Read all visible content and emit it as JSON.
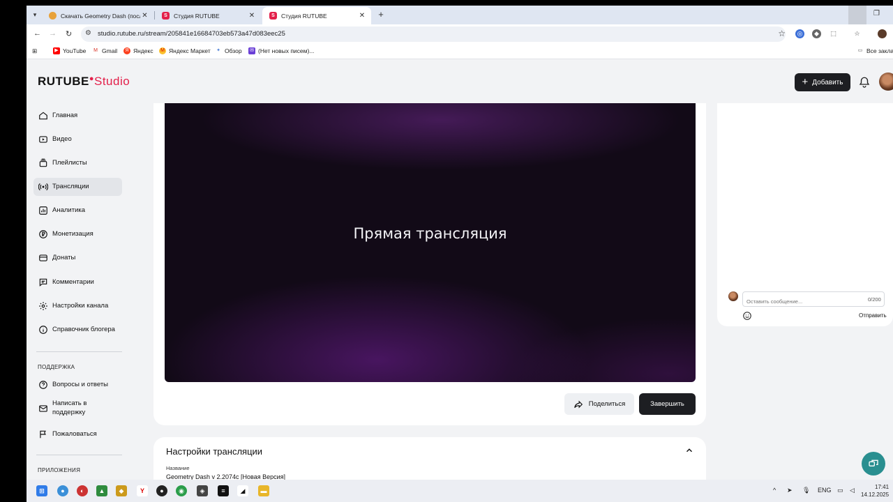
{
  "browser": {
    "tabs": [
      {
        "title": "Скачать Geometry Dash (после",
        "icon": "geometry-dash-favicon"
      },
      {
        "title": "Студия RUTUBE",
        "icon": "rutube-favicon"
      },
      {
        "title": "Студия RUTUBE",
        "icon": "rutube-favicon",
        "active": true
      }
    ],
    "url": "studio.rutube.ru/stream/205841e16684703eb573a47d083eec25",
    "bookmarks": [
      "YouTube",
      "Gmail",
      "Яндекс",
      "Яндекс Маркет",
      "Обзор",
      "(Нет новых писем)..."
    ],
    "all_bookmarks": "Все закла"
  },
  "header": {
    "logo_main": "RUTUBE",
    "logo_studio": "Studio",
    "add_button": "Добавить"
  },
  "sidebar": {
    "items": [
      {
        "label": "Главная",
        "icon": "home-icon"
      },
      {
        "label": "Видео",
        "icon": "video-icon"
      },
      {
        "label": "Плейлисты",
        "icon": "playlist-icon"
      },
      {
        "label": "Трансляции",
        "icon": "broadcast-icon",
        "active": true
      },
      {
        "label": "Аналитика",
        "icon": "analytics-icon"
      },
      {
        "label": "Монетизация",
        "icon": "ruble-icon"
      },
      {
        "label": "Донаты",
        "icon": "donate-icon"
      },
      {
        "label": "Комментарии",
        "icon": "comment-icon"
      },
      {
        "label": "Настройки канала",
        "icon": "gear-icon"
      },
      {
        "label": "Справочник блогера",
        "icon": "info-icon"
      }
    ],
    "support_heading": "ПОДДЕРЖКА",
    "support_items": [
      {
        "label": "Вопросы и ответы",
        "icon": "question-icon"
      },
      {
        "label": "Написать в поддержку",
        "icon": "mail-icon"
      },
      {
        "label": "Пожаловаться",
        "icon": "flag-icon"
      }
    ],
    "apps_heading": "ПРИЛОЖЕНИЯ"
  },
  "player": {
    "title": "Прямая трансляция",
    "share_button": "Поделиться",
    "finish_button": "Завершить"
  },
  "settings": {
    "title": "Настройки трансляции",
    "name_label": "Название",
    "name_value": "Geometry Dash v 2.2074c [Новая Версия]"
  },
  "chat": {
    "placeholder": "Оставить сообщение...",
    "counter": "0/200",
    "send_button": "Отправить"
  },
  "taskbar": {
    "lang": "ENG",
    "time": "17:41",
    "date": "14.12.2025"
  },
  "colors": {
    "brand": "#e3204a",
    "dark_button": "#1d1e22",
    "help_fab": "#2a8f90"
  }
}
